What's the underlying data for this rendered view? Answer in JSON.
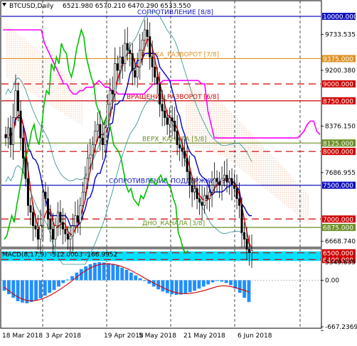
{
  "header": {
    "symbol": "BTCUSD,Daily",
    "ohlc": "6521.980 6570.210 6470.290 6533.550"
  },
  "macd_header": {
    "title": "MACD(8,17,9)",
    "values": "-312.0003 -166.9952"
  },
  "colors": {
    "background": "#ffffff",
    "ichimoku_cloud": "#e8a070",
    "support_resistance_line": "#1010c0",
    "red_level": "#d00000",
    "orange_level": "#e09020",
    "olive_level": "#6b8e23",
    "magenta_line": "#ff00ff",
    "green_line": "#00c000",
    "blue_line": "#0000c0",
    "red_line": "#e00000",
    "cyan_band": "#00e0ff",
    "macd_hist": "#1f8fff",
    "macd_signal": "#d00000",
    "band_line": "#2a8a8a"
  },
  "price_axis": {
    "ticks": [
      "9733.535",
      "9200.380",
      "8376.150",
      "7686.955",
      "6668.740",
      "5349.635"
    ],
    "ylim": [
      6329.535,
      10200
    ]
  },
  "levels": [
    {
      "label": "СОПРОТИВЛЕНИЕ [8/8]",
      "value": 10000,
      "tag": "10000.000",
      "color": "#1010c0",
      "style": "solid"
    },
    {
      "label": "БЛОКА_РАЗВОРОТ [7/8]",
      "value": 9375,
      "tag": "9375.000",
      "color": "#e09020",
      "style": "solid"
    },
    {
      "label": "",
      "value": 9000,
      "tag": "9000.000",
      "color": "#d00000",
      "style": "dashed"
    },
    {
      "label": "ВРАЩЕНИЕ_РАЗВОРОТ [6/8]",
      "value": 8750,
      "tag": "8750.000",
      "color": "#d00000",
      "style": "solid"
    },
    {
      "label": "ВЕРХ_КАНАЛА [5/8]",
      "value": 8125,
      "tag": "8125.000",
      "color": "#6b8e23",
      "style": "solid"
    },
    {
      "label": "",
      "value": 8000,
      "tag": "8000.000",
      "color": "#d00000",
      "style": "dashed"
    },
    {
      "label": "СОПРОТИВЛЕНИЕ_ПОДДЕРЖКИ [4/8]",
      "value": 7500,
      "tag": "7500.000",
      "color": "#1010c0",
      "style": "solid"
    },
    {
      "label": "",
      "value": 7000,
      "tag": "7000.000",
      "color": "#d00000",
      "style": "dashed"
    },
    {
      "label": "ДНО_КАНАЛА [3/8]",
      "value": 6875,
      "tag": "6875.000",
      "color": "#6b8e23",
      "style": "solid"
    },
    {
      "label": "",
      "value": 6500,
      "tag": "6500.000",
      "color": "#d00000",
      "style": "dashed"
    },
    {
      "label": "",
      "value": 6400,
      "tag": "6400.000",
      "color": "#d00000",
      "style": "dashed"
    }
  ],
  "chart_data": {
    "type": "candlestick",
    "x_labels": [
      "18 Mar 2018",
      "3 Apr 2018",
      "19 Apr 2018",
      "5 May 2018",
      "21 May 2018",
      "6 Jun 2018"
    ],
    "closes": [
      8200,
      8350,
      8100,
      8500,
      8900,
      8600,
      8200,
      7900,
      7600,
      7200,
      7100,
      6900,
      6850,
      6700,
      6900,
      7400,
      7300,
      7000,
      6850,
      6700,
      6900,
      7100,
      6950,
      6850,
      6780,
      6700,
      6750,
      6900,
      7050,
      6950,
      7200,
      7400,
      7600,
      7900,
      7950,
      8100,
      8300,
      8400,
      8200,
      8100,
      8350,
      8700,
      8900,
      8850,
      9300,
      9200,
      9400,
      9300,
      9600,
      9500,
      9450,
      9200,
      9100,
      9250,
      9500,
      9650,
      9800,
      9700,
      9400,
      9250,
      9100,
      9000,
      8700,
      8600,
      8500,
      8400,
      8500,
      8450,
      8300,
      8100,
      8050,
      8000,
      7900,
      7700,
      7500,
      7400,
      7450,
      7300,
      7250,
      7200,
      7350,
      7300,
      7400,
      7500,
      7600,
      7550,
      7500,
      7600,
      7650,
      7550,
      7600,
      7500,
      7450,
      7300,
      7200,
      6800,
      6700,
      6550,
      6500,
      6533
    ],
    "ichimoku_span_a": [
      9000,
      9000,
      8950,
      8950,
      8900,
      8900,
      8850,
      8850,
      8800,
      8800,
      8750,
      8700,
      8700,
      8650,
      8600,
      8550,
      8500,
      8450,
      8400,
      8350,
      8300,
      8250,
      8200,
      8150,
      8100,
      8050,
      8000,
      7950,
      7900,
      7850,
      7800,
      7750,
      7700,
      7650,
      7600,
      7550,
      7500,
      7450,
      7400,
      7350
    ],
    "magenta_line": [
      9800,
      9800,
      9800,
      9800,
      9800,
      9800,
      9800,
      9800,
      9800,
      9800,
      9800,
      9800,
      9800,
      9600,
      9500,
      9400,
      9300,
      9200,
      9100,
      9000,
      9000,
      8900,
      8850,
      8850,
      8900,
      8900,
      8950,
      8950,
      8950,
      9000,
      9050,
      9000,
      8950,
      8950,
      8900,
      8900,
      8850,
      8850,
      8850,
      8850,
      8850,
      8850,
      8850,
      8850,
      8850,
      8900,
      8950,
      9000,
      9000,
      9000,
      9050,
      9050,
      9050,
      9050,
      9050,
      9050,
      9050,
      9050,
      9050,
      9050,
      9050,
      9050,
      9000,
      9000,
      8600,
      8400,
      8200,
      8200,
      8200,
      8200,
      8200,
      8200,
      8200,
      8200,
      8200,
      8200,
      8200,
      8200,
      8200,
      8200,
      8200,
      8200,
      8200,
      8200,
      8200,
      8200,
      8200,
      8200,
      8200,
      8200,
      8200,
      8200,
      8200,
      8250,
      8300,
      8400,
      8450,
      8450,
      8300,
      8250
    ],
    "macd_hist": [
      -150,
      -200,
      -250,
      -300,
      -320,
      -330,
      -310,
      -290,
      -260,
      -220,
      -180,
      -140,
      -90,
      -40,
      10,
      60,
      110,
      160,
      200,
      230,
      250,
      260,
      255,
      245,
      230,
      210,
      180,
      150,
      110,
      70,
      30,
      -10,
      -50,
      -90,
      -130,
      -160,
      -185,
      -200,
      -210,
      -205,
      -190,
      -170,
      -150,
      -120,
      -90,
      -60,
      -30,
      -10,
      -20,
      -40,
      -70,
      -120,
      -180,
      -250,
      -312
    ],
    "macd_signal": [
      -100,
      -150,
      -200,
      -240,
      -270,
      -290,
      -295,
      -290,
      -275,
      -250,
      -220,
      -185,
      -145,
      -100,
      -55,
      -5,
      45,
      95,
      140,
      175,
      205,
      225,
      235,
      235,
      230,
      215,
      195,
      170,
      140,
      105,
      70,
      30,
      -5,
      -40,
      -75,
      -105,
      -135,
      -160,
      -180,
      -190,
      -192,
      -188,
      -180,
      -165,
      -150,
      -130,
      -110,
      -90,
      -80,
      -80,
      -90,
      -105,
      -125,
      -145,
      -167
    ],
    "macd_axis_ticks": [
      "0.00",
      "-667.2369"
    ]
  }
}
